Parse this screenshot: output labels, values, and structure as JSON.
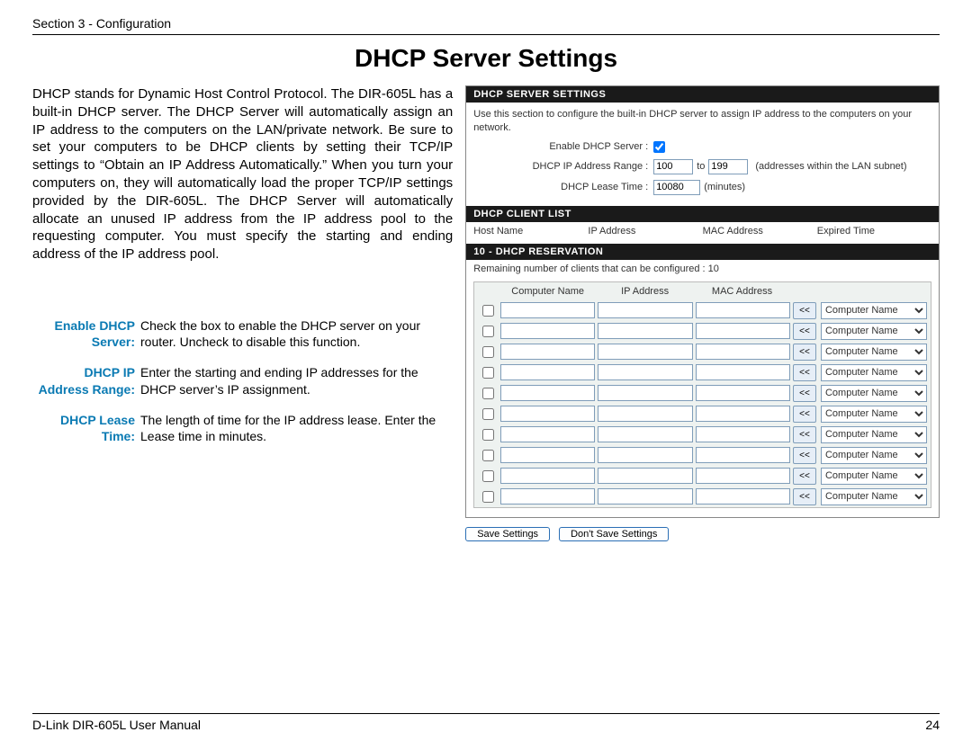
{
  "doc": {
    "section_label": "Section 3 - Configuration",
    "title": "DHCP Server Settings",
    "intro": "DHCP stands for Dynamic Host Control Protocol. The DIR-605L has a built-in DHCP server. The DHCP Server will automatically assign an IP address to the computers on the LAN/private network. Be sure to set your computers to be DHCP clients by setting their TCP/IP settings to “Obtain an IP Address Automatically.” When you turn your computers on, they will automatically load the proper TCP/IP settings provided by the DIR-605L. The DHCP Server will automatically allocate an unused IP address from the IP address pool to the requesting computer. You must specify the starting and ending address of the IP address pool.",
    "defs": [
      {
        "term": "Enable DHCP Server:",
        "desc": "Check the box to enable the DHCP server on your router. Uncheck to disable this function."
      },
      {
        "term": "DHCP IP Address Range:",
        "desc": "Enter the starting and ending IP addresses for the DHCP server’s IP assignment."
      },
      {
        "term": "DHCP Lease Time:",
        "desc": "The length of time for the IP address lease. Enter the Lease time in minutes."
      }
    ],
    "footer_left": "D-Link DIR-605L User Manual",
    "footer_page": "24"
  },
  "panel": {
    "h1": "DHCP SERVER SETTINGS",
    "desc": "Use this section to configure the built-in DHCP server to assign IP address to the computers on your network.",
    "enable_label": "Enable DHCP Server :",
    "range_label": "DHCP IP Address Range :",
    "range_start": "100",
    "range_to": "to",
    "range_end": "199",
    "range_note": "(addresses within the LAN subnet)",
    "lease_label": "DHCP Lease Time :",
    "lease_value": "10080",
    "lease_unit": "(minutes)",
    "h2": "DHCP CLIENT LIST",
    "client_headers": [
      "Host Name",
      "IP Address",
      "MAC Address",
      "Expired Time"
    ],
    "h3": "10 - DHCP RESERVATION",
    "res_note": "Remaining number of clients that can be configured : 10",
    "res_headers": [
      "Computer Name",
      "IP Address",
      "MAC Address"
    ],
    "arrow_label": "<<",
    "select_option": "Computer Name",
    "row_count": 10,
    "save_label": "Save Settings",
    "dont_save_label": "Don't Save Settings"
  }
}
